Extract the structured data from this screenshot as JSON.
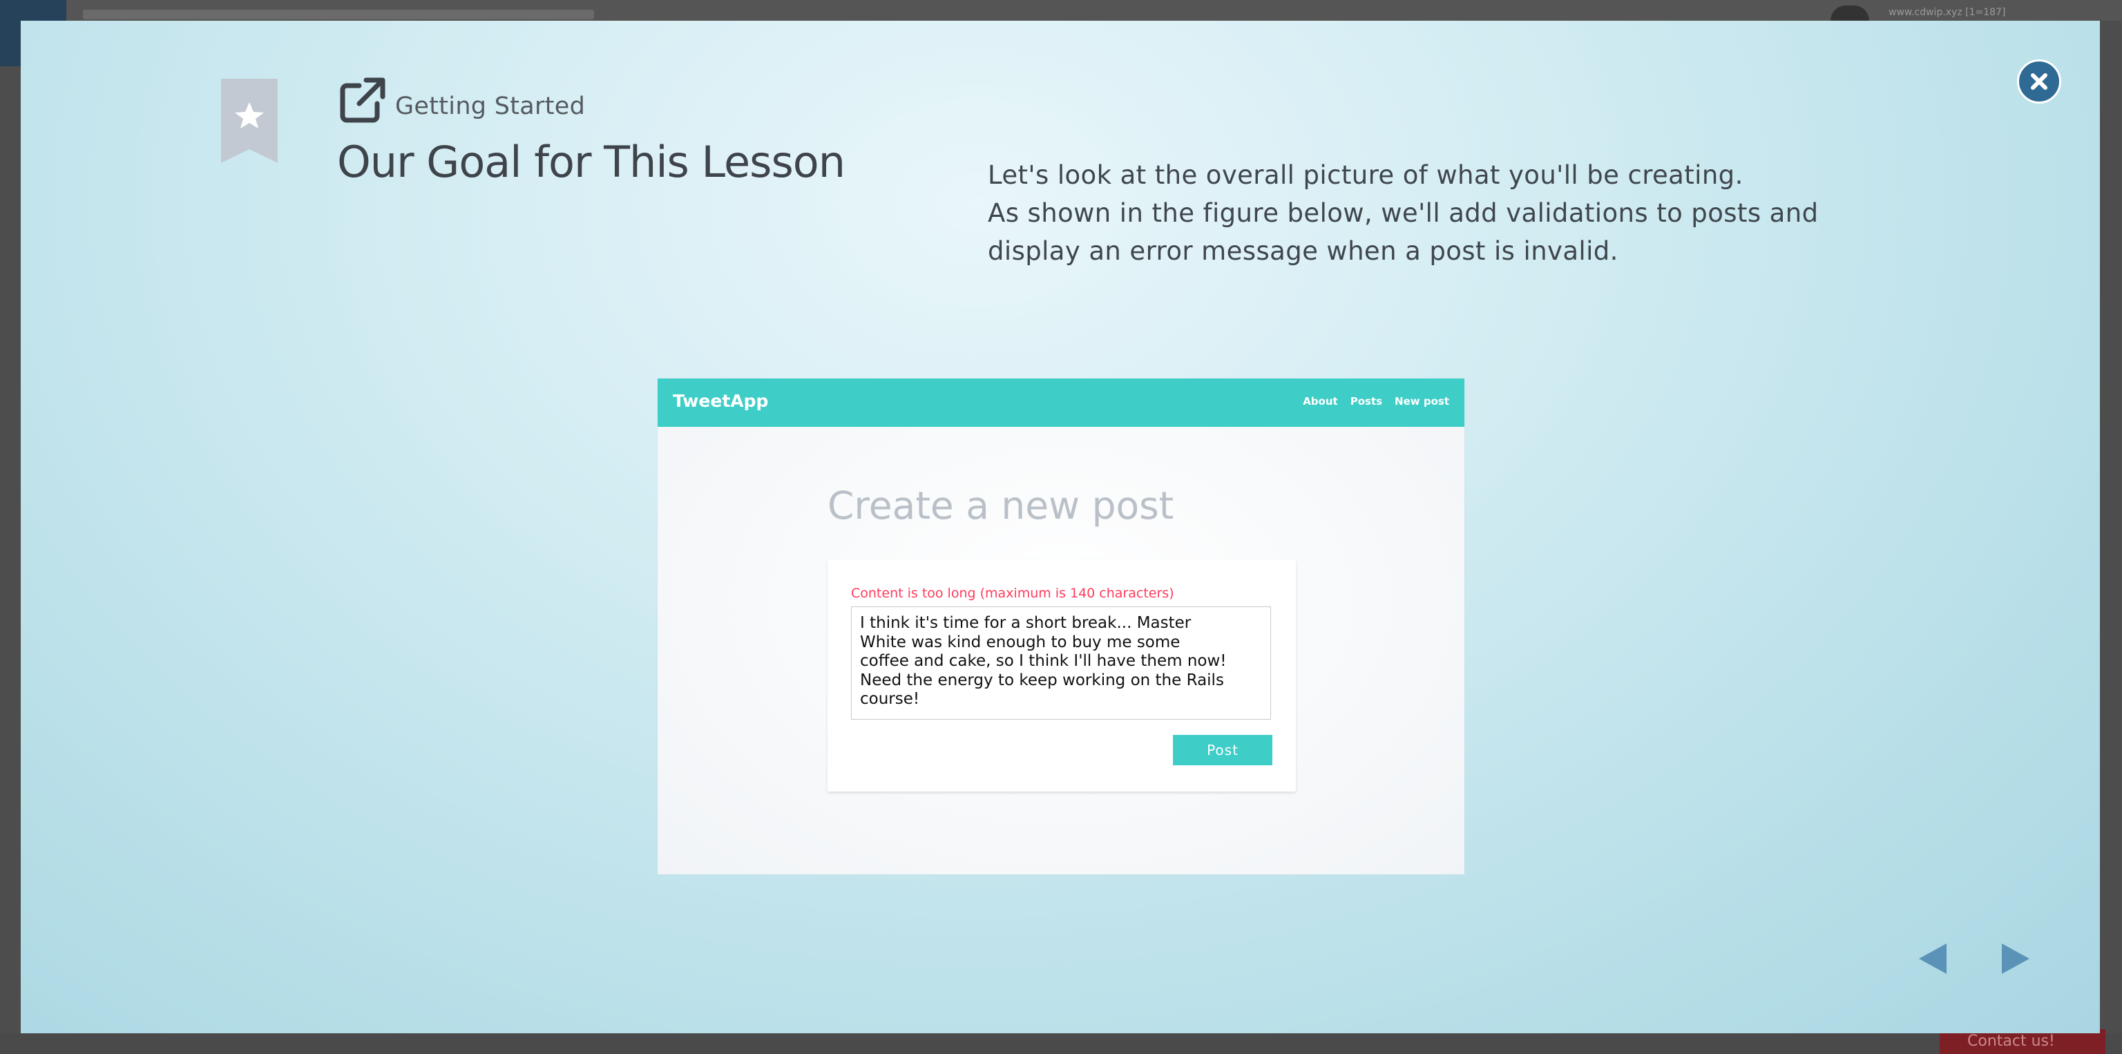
{
  "background": {
    "user_text": "www.cdwip.xyz [1=187]",
    "contact_label": "Contact us!"
  },
  "lesson": {
    "section": "Getting Started",
    "title": "Our Goal for This Lesson",
    "description": [
      "Let's look at the overall picture of what you'll be creating.",
      "As shown in the figure below, we'll add validations to posts and display an error message when a post is invalid."
    ]
  },
  "figure": {
    "brand": "TweetApp",
    "nav": [
      "About",
      "Posts",
      "New post"
    ],
    "heading": "Create a new post",
    "error_message": "Content is too long (maximum is 140 characters)",
    "textarea_value": "I think it's time for a short break... Master\nWhite was kind enough to buy me some\ncoffee and cake, so I think I'll have them now!\nNeed the energy to keep working on the Rails\ncourse!",
    "submit_label": "Post"
  },
  "icons": {
    "bookmark": "bookmark-star-icon",
    "section": "external-link-icon",
    "close": "close-icon",
    "prev": "triangle-left-icon",
    "next": "triangle-right-icon"
  },
  "colors": {
    "accent": "#3ecec7",
    "error": "#ff3b5c",
    "close_button": "#2f6a95",
    "nav_arrow": "#5b93b8"
  }
}
